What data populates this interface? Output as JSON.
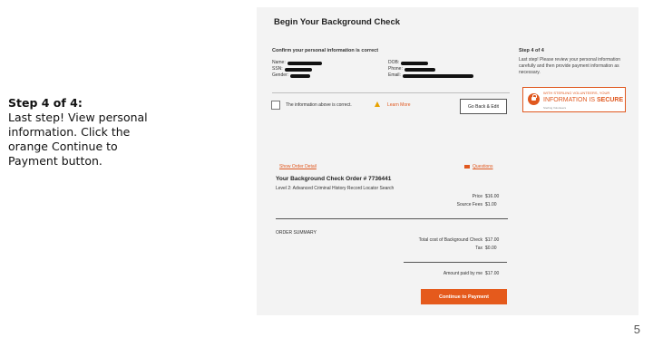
{
  "caption": {
    "step": "Step 4 of 4:",
    "line1": "Last step! View personal",
    "line2": "information. Click the",
    "line3": "orange Continue to",
    "line4": "Payment button."
  },
  "slide_number": "5",
  "panel": {
    "title": "Begin Your Background Check",
    "confirm_heading": "Confirm your personal information is correct",
    "fields_left": {
      "name": "Name:",
      "ssn": "SSN:",
      "gender": "Gender:"
    },
    "fields_right": {
      "dob": "DOB:",
      "phone": "Phone:",
      "email": "Email:"
    },
    "checkbox_label": "The information above is correct.",
    "learn_more": "Learn More",
    "go_back": "Go Back & Edit",
    "sidebar": {
      "step": "Step 4 of 4",
      "text": "Last step! Please review your personal information carefully and then provide payment information as necessary."
    },
    "secure_badge": {
      "line1": "WITH STERLING VOLUNTEERS, YOUR",
      "line2_a": "INFORMATION IS ",
      "line2_b": "SECURE",
      "line3": "Sterling Volunteers"
    },
    "show_order_detail": "Show Order Detail",
    "questions": "Questions",
    "order_title": "Your Background Check Order # 7736441",
    "order_level": "Level 2: Advanced Criminal History Record Locator Search",
    "price_label": "Price",
    "price_value": "$16.00",
    "source_fees_label": "Source Fees",
    "source_fees_value": "$1.00",
    "order_summary": "ORDER SUMMARY",
    "total_label": "Total cost of Background Check",
    "total_value": "$17.00",
    "tax_label": "Tax",
    "tax_value": "$0.00",
    "paid_label": "Amount paid by me",
    "paid_value": "$17.00",
    "continue_button": "Continue to Payment"
  },
  "colors": {
    "accent": "#e55a1c",
    "panel_bg": "#f3f3f3"
  }
}
